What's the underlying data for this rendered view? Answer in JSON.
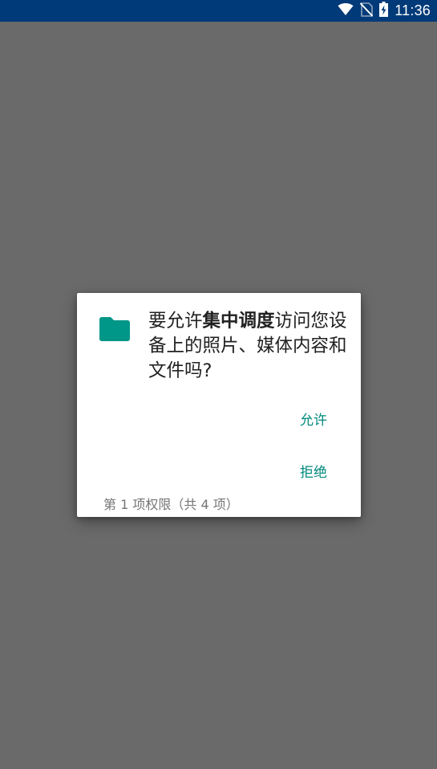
{
  "status_bar": {
    "time": "11:36",
    "icons": [
      "wifi-icon",
      "no-sim-icon",
      "battery-charging-icon"
    ],
    "background": "#003a78"
  },
  "dialog": {
    "icon": "folder-icon",
    "icon_color": "#009688",
    "message_prefix": "要允许",
    "app_name": "集中调度",
    "message_suffix": "访问您设备上的照片、媒体内容和文件吗?",
    "allow_label": "允许",
    "deny_label": "拒绝",
    "permission_counter": "第 1 项权限（共 4 项）",
    "button_color": "#00897b"
  },
  "scrim_color": "#6a6a6a"
}
